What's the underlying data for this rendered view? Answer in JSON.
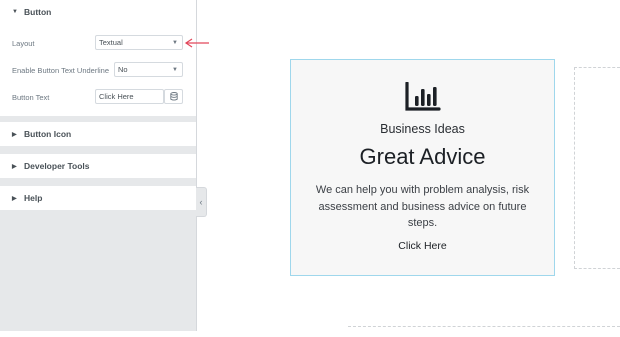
{
  "panel": {
    "button_section": {
      "title": "Button",
      "layout_label": "Layout",
      "layout_value": "Textual",
      "underline_label": "Enable Button Text Underline",
      "underline_value": "No",
      "text_label": "Button Text",
      "text_value": "Click Here"
    },
    "sections": [
      {
        "title": "Button Icon"
      },
      {
        "title": "Developer Tools"
      },
      {
        "title": "Help"
      }
    ]
  },
  "card": {
    "icon": "bar-chart-icon",
    "subtitle": "Business Ideas",
    "title": "Great Advice",
    "description": "We can help you with problem analysis, risk assessment and business advice on future steps.",
    "cta": "Click Here"
  },
  "colors": {
    "panel_bg": "#e6e8ea",
    "card_border": "#9fd7ec",
    "pointer_arrow": "#e2475b"
  }
}
